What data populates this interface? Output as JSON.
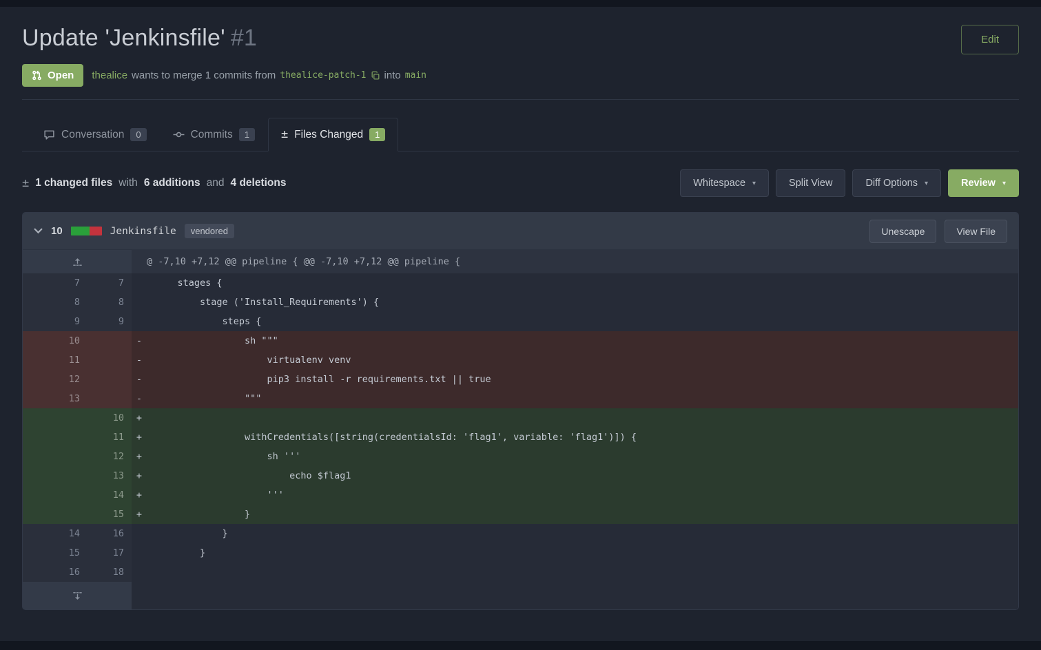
{
  "page": {
    "title": "Update 'Jenkinsfile'",
    "number": "#1",
    "edit_button": "Edit"
  },
  "meta": {
    "status": "Open",
    "author": "thealice",
    "merge_text_1": "wants to merge 1 commits from",
    "source_branch": "thealice-patch-1",
    "merge_text_2": "into",
    "target_branch": "main"
  },
  "tabs": [
    {
      "label": "Conversation",
      "count": "0"
    },
    {
      "label": "Commits",
      "count": "1"
    },
    {
      "label": "Files Changed",
      "count": "1"
    }
  ],
  "toolbar": {
    "changed_files": "1 changed files",
    "with_text": "with",
    "additions": "6 additions",
    "and_text": "and",
    "deletions": "4 deletions",
    "whitespace": "Whitespace",
    "split_view": "Split View",
    "diff_options": "Diff Options",
    "review": "Review"
  },
  "file": {
    "changes": "10",
    "name": "Jenkinsfile",
    "badge": "vendored",
    "unescape": "Unescape",
    "view_file": "View File",
    "hunk": "@ -7,10 +7,12 @@ pipeline { @@ -7,10 +7,12 @@ pipeline {",
    "lines": [
      {
        "old": "7",
        "new": "7",
        "sign": "",
        "type": "context",
        "code": "    stages {"
      },
      {
        "old": "8",
        "new": "8",
        "sign": "",
        "type": "context",
        "code": "        stage ('Install_Requirements') {"
      },
      {
        "old": "9",
        "new": "9",
        "sign": "",
        "type": "context",
        "code": "            steps {"
      },
      {
        "old": "10",
        "new": "",
        "sign": "-",
        "type": "del",
        "code": "                sh \"\"\""
      },
      {
        "old": "11",
        "new": "",
        "sign": "-",
        "type": "del",
        "code": "                    virtualenv venv"
      },
      {
        "old": "12",
        "new": "",
        "sign": "-",
        "type": "del",
        "code": "                    pip3 install -r requirements.txt || true"
      },
      {
        "old": "13",
        "new": "",
        "sign": "-",
        "type": "del",
        "code": "                \"\"\""
      },
      {
        "old": "",
        "new": "10",
        "sign": "+",
        "type": "add",
        "code": ""
      },
      {
        "old": "",
        "new": "11",
        "sign": "+",
        "type": "add",
        "code": "                withCredentials([string(credentialsId: 'flag1', variable: 'flag1')]) {"
      },
      {
        "old": "",
        "new": "12",
        "sign": "+",
        "type": "add",
        "code": "                    sh '''"
      },
      {
        "old": "",
        "new": "13",
        "sign": "+",
        "type": "add",
        "code": "                        echo $flag1"
      },
      {
        "old": "",
        "new": "14",
        "sign": "+",
        "type": "add",
        "code": "                    '''"
      },
      {
        "old": "",
        "new": "15",
        "sign": "+",
        "type": "add",
        "code": "                }"
      },
      {
        "old": "14",
        "new": "16",
        "sign": "",
        "type": "context",
        "code": "            }"
      },
      {
        "old": "15",
        "new": "17",
        "sign": "",
        "type": "context",
        "code": "        }"
      },
      {
        "old": "16",
        "new": "18",
        "sign": "",
        "type": "context",
        "code": ""
      }
    ]
  },
  "colors": {
    "accent_green": "#87ab63",
    "stat_add": "#2aa03a",
    "stat_del": "#c4333d",
    "diff_add_bg": "#2b3b2e",
    "diff_del_bg": "#3d2a2b"
  },
  "icons": {
    "pull_request": "git-pull-request-icon",
    "diff_glyph": "±",
    "caret_glyph": "▾"
  }
}
